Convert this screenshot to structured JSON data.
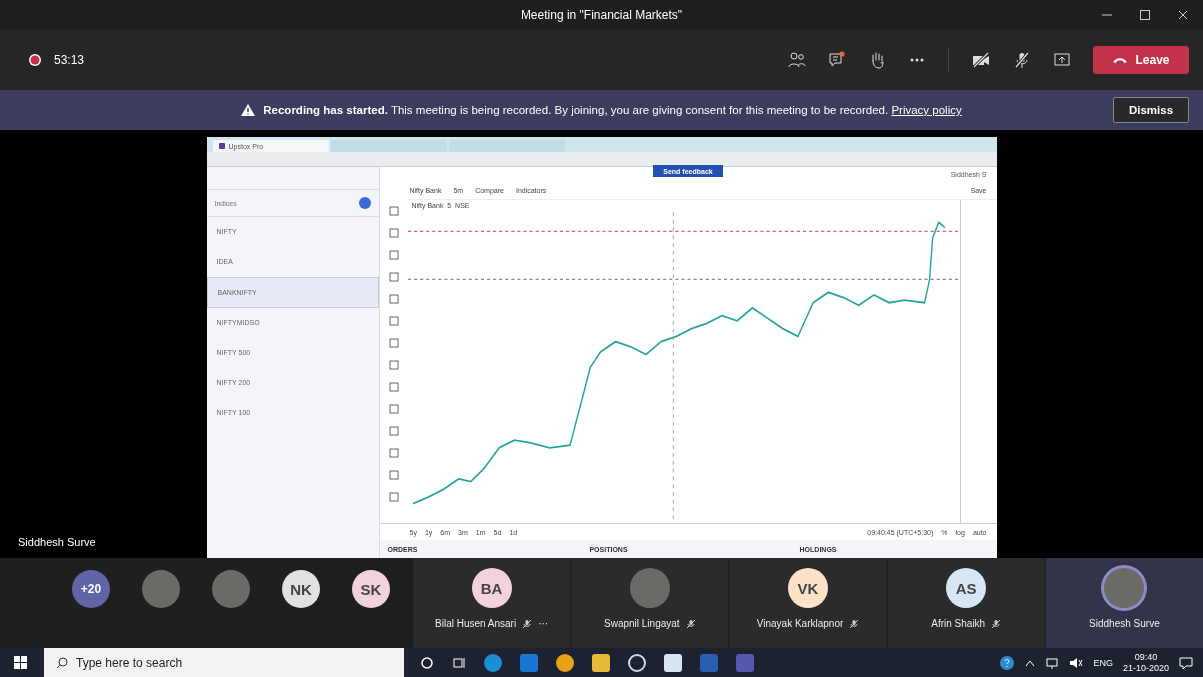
{
  "window": {
    "title": "Meeting in \"Financial Markets\""
  },
  "meeting_bar": {
    "timer": "53:13",
    "recording": true,
    "chat_unread": true,
    "camera_on": false,
    "mic_on": false,
    "leave_label": "Leave"
  },
  "banner": {
    "text": "**Recording has started.** This meeting is being recorded. By joining, you are giving consent for this meeting to be recorded.",
    "link": "Privacy policy",
    "dismiss": "Dismiss"
  },
  "shared_screen": {
    "browser_tabs": [
      {
        "label": "Upstox Pro",
        "selected": true
      },
      {
        "selected": false
      },
      {
        "selected": false
      }
    ],
    "send_feedback": "Send feedback",
    "user": "Siddhesh S",
    "search": {
      "value": "Indices"
    },
    "watchlist": [
      {
        "name": "NIFTY",
        "selected": false
      },
      {
        "name": "IDEA",
        "selected": false
      },
      {
        "name": "BANKNIFTY",
        "selected": true
      },
      {
        "name": "NIFTYMIDSO",
        "selected": false
      },
      {
        "name": "NIFTY 500",
        "selected": false
      },
      {
        "name": "NIFTY 200",
        "selected": false
      },
      {
        "name": "NIFTY 100",
        "selected": false
      }
    ],
    "symbol": "Nifty Bank",
    "interval": "5m",
    "compare": "Compare",
    "indicators": "Indicators",
    "save": "Save",
    "legend": "Nifty Bank  5  NSE",
    "ranges": [
      "5y",
      "1y",
      "6m",
      "3m",
      "1m",
      "5d",
      "1d"
    ],
    "clock": "09:40:45 (UTC+5:30)",
    "scale_options": [
      "%",
      "log",
      "auto"
    ],
    "footer": [
      "ORDERS",
      "POSITIONS",
      "HOLDINGS"
    ]
  },
  "presenter_label": "Siddhesh Surve",
  "participants": [
    {
      "kind": "count",
      "label": "+20",
      "color": "#6264a7"
    },
    {
      "kind": "photo"
    },
    {
      "kind": "photo"
    },
    {
      "kind": "initials",
      "label": "NK",
      "color": "#e1e1e1"
    },
    {
      "kind": "initials",
      "label": "SK",
      "color": "#f3d2e0"
    }
  ],
  "tiles": [
    {
      "kind": "initials",
      "initials": "BA",
      "color": "#f3d2e0",
      "name": "Bilal Husen Ansari",
      "muted": true,
      "more": "···",
      "active": false
    },
    {
      "kind": "photo",
      "name": "Swapnil Lingayat",
      "muted": true,
      "active": false
    },
    {
      "kind": "initials",
      "initials": "VK",
      "color": "#fbe2c8",
      "name": "Vinayak Karklapnor",
      "muted": true,
      "active": false
    },
    {
      "kind": "initials",
      "initials": "AS",
      "color": "#d6e6f5",
      "name": "Afrin Shaikh",
      "muted": true,
      "active": false
    },
    {
      "kind": "photo",
      "name": "Siddhesh Surve",
      "muted": false,
      "active": true
    }
  ],
  "taskbar": {
    "search_placeholder": "Type here to search",
    "language": "ENG",
    "time": "09:40",
    "date": "21-10-2020"
  }
}
